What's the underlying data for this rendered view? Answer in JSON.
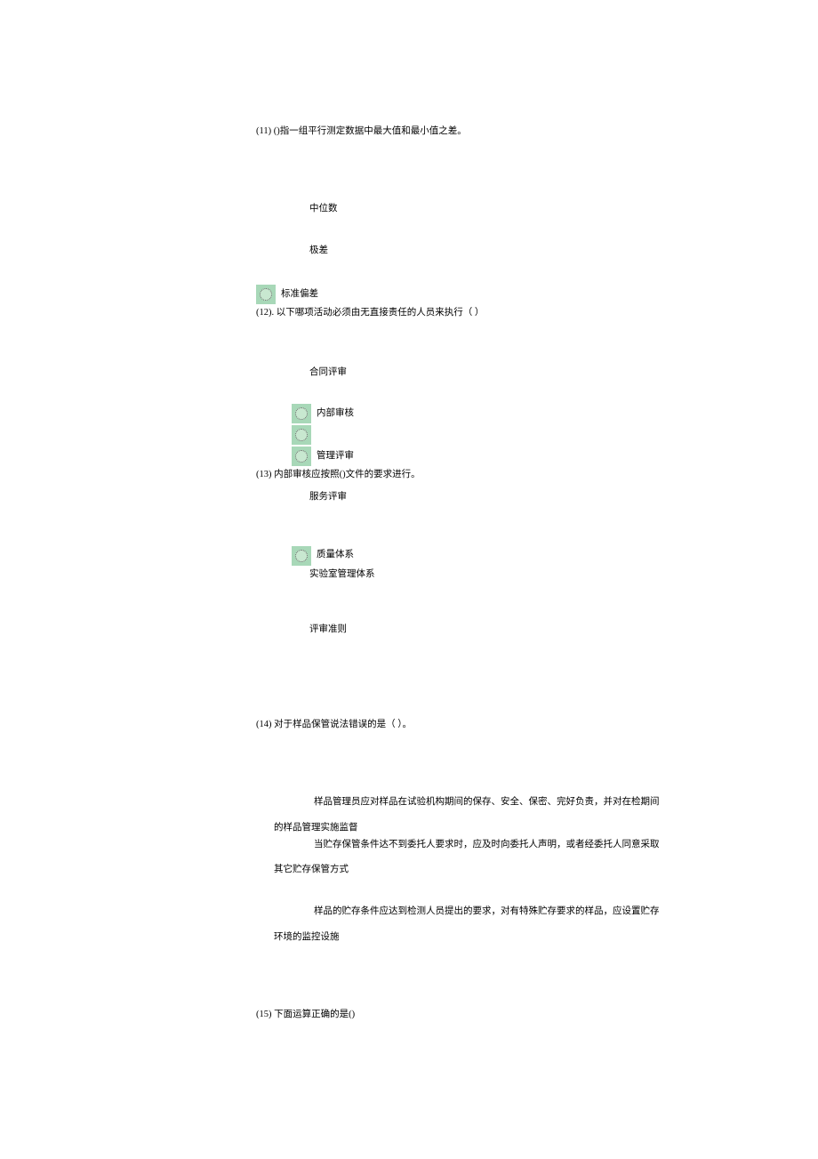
{
  "q11": {
    "header": "(11) ()指一组平行测定数据中最大值和最小值之差。",
    "opts": [
      "中位数",
      "极差",
      "标准偏差"
    ]
  },
  "q12": {
    "header": "(12). 以下哪项活动必须由无直接责任的人员来执行（                    ）",
    "opts": [
      "合同评审",
      "内部审核",
      "管理评审",
      "服务评审"
    ]
  },
  "q13": {
    "header": "(13) 内部审核应按照()文件的要求进行。",
    "opts": [
      "质量体系",
      "实验室管理体系",
      "评审准则"
    ]
  },
  "q14": {
    "header": "(14) 对于样品保管说法错误的是（              ）。",
    "opts": [
      {
        "lead": "样品管理员应对样品在试验机构期间的保存、安全、保密、完好负责，并对在检期间",
        "cont": "的样品管理实施监督"
      },
      {
        "lead": "当贮存保管条件达不到委托人要求时，应及时向委托人声明，或者经委托人同意采取",
        "cont": "其它贮存保管方式"
      },
      {
        "lead": "样品的贮存条件应达到检测人员提出的要求，对有特殊贮存要求的样品，应设置贮存",
        "cont": "环境的监控设施"
      }
    ]
  },
  "q15": {
    "header": "(15) 下面运算正确的是()"
  }
}
